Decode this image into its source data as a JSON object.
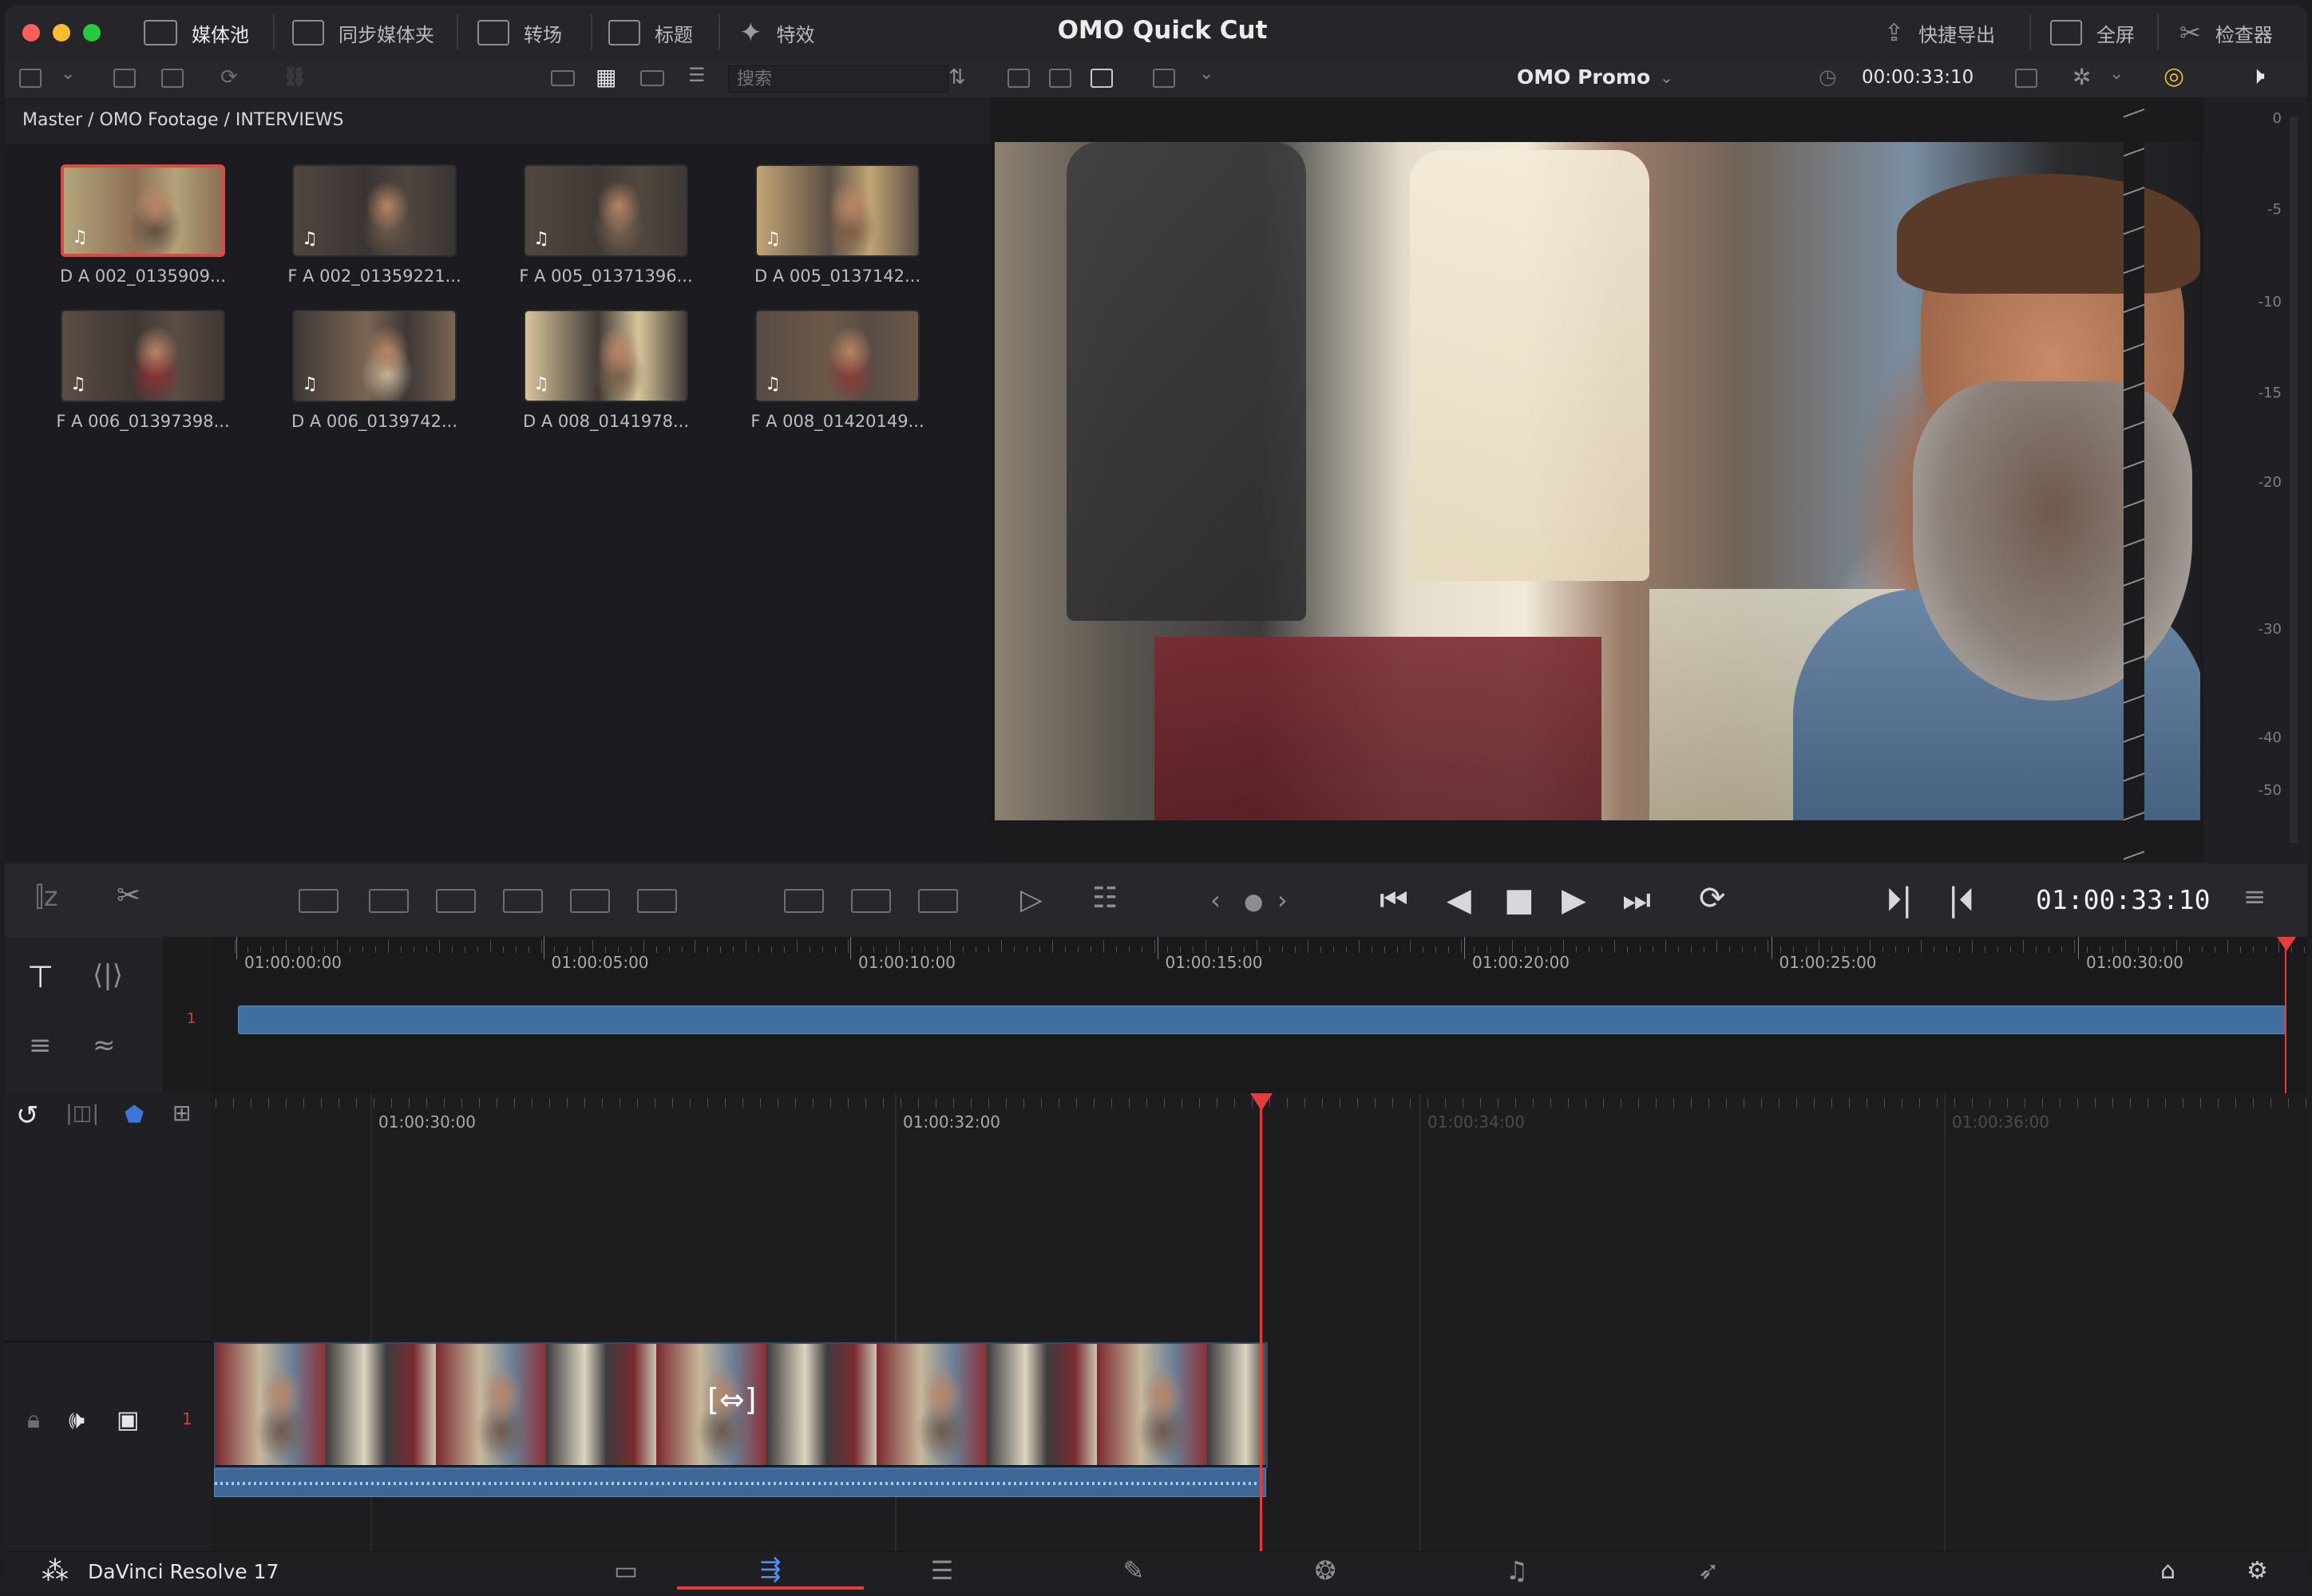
{
  "app": {
    "title": "OMO Quick Cut",
    "name": "DaVinci Resolve 17"
  },
  "top_tabs": [
    {
      "label": "媒体池",
      "icon": "media-pool-icon"
    },
    {
      "label": "同步媒体夹",
      "icon": "sync-bin-icon"
    },
    {
      "label": "转场",
      "icon": "transitions-icon"
    },
    {
      "label": "标题",
      "icon": "titles-icon"
    },
    {
      "label": "特效",
      "icon": "effects-icon"
    }
  ],
  "top_right": {
    "quick_export": "快捷导出",
    "fullscreen": "全屏",
    "inspector": "检查器"
  },
  "toolbar": {
    "search_placeholder": "搜索",
    "viewer_name": "OMO Promo",
    "source_timecode": "00:00:33:10"
  },
  "breadcrumb": "Master / OMO Footage / INTERVIEWS",
  "clips": [
    {
      "name": "D A 002_0135909...",
      "selected": true
    },
    {
      "name": "F A 002_01359221...",
      "selected": false
    },
    {
      "name": "F A 005_01371396...",
      "selected": false
    },
    {
      "name": "D A 005_0137142...",
      "selected": false
    },
    {
      "name": "F A 006_01397398...",
      "selected": false
    },
    {
      "name": "D A 006_0139742...",
      "selected": false
    },
    {
      "name": "D A 008_0141978...",
      "selected": false
    },
    {
      "name": "F A 008_01420149...",
      "selected": false
    }
  ],
  "meter": {
    "labels": [
      "0",
      "-5",
      "-10",
      "-15",
      "-20",
      "-30",
      "-40",
      "-50"
    ]
  },
  "transport": {
    "timecode": "01:00:33:10"
  },
  "upper_ruler": [
    "01:00:00:00",
    "01:00:05:00",
    "01:00:10:00",
    "01:00:15:00",
    "01:00:20:00",
    "01:00:25:00",
    "01:00:30:00"
  ],
  "lower_ruler": [
    "01:00:30:00",
    "01:00:32:00",
    "01:00:34:00",
    "01:00:36:00"
  ],
  "tracks": {
    "upper_index": "1",
    "lower_index": "1"
  },
  "colors": {
    "accent_red": "#e53c3c",
    "clip_blue": "#3f6f9f",
    "audio_blue": "#3d6796",
    "bg": "#1e1e22"
  },
  "page_nav": [
    "media-page-icon",
    "cut-page-icon",
    "edit-page-icon",
    "fusion-page-icon",
    "color-page-icon",
    "fairlight-page-icon",
    "deliver-page-icon"
  ]
}
